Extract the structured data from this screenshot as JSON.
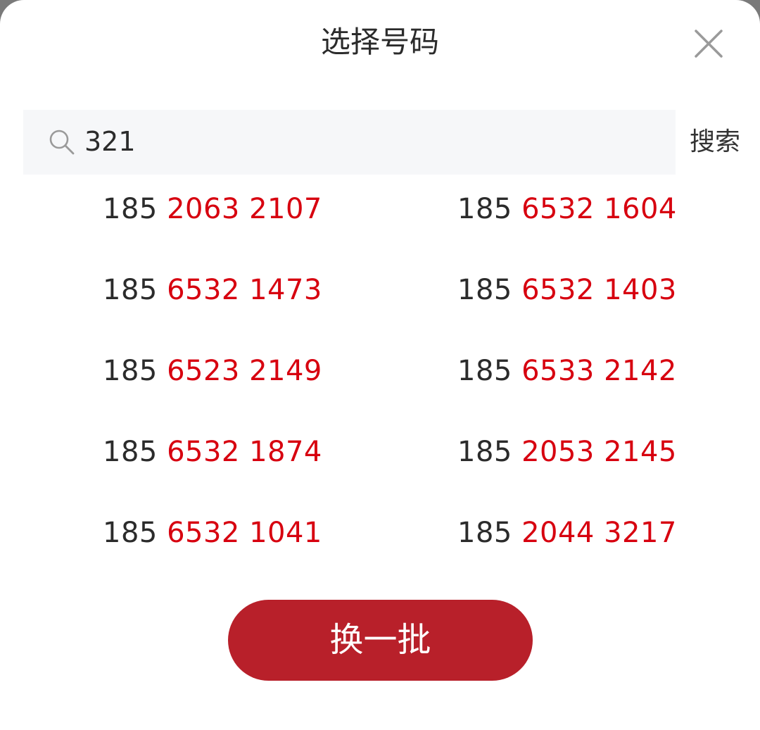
{
  "dialog": {
    "title": "选择号码"
  },
  "search": {
    "value": "321",
    "button_label": "搜索"
  },
  "numbers": [
    {
      "prefix": "185 ",
      "highlight": "2063 2107"
    },
    {
      "prefix": "185 ",
      "highlight": "6532 1604"
    },
    {
      "prefix": "185 ",
      "highlight": "6532 1473"
    },
    {
      "prefix": "185 ",
      "highlight": "6532 1403"
    },
    {
      "prefix": "185 ",
      "highlight": "6523 2149"
    },
    {
      "prefix": "185 ",
      "highlight": "6533 2142"
    },
    {
      "prefix": "185 ",
      "highlight": "6532 1874"
    },
    {
      "prefix": "185 ",
      "highlight": "2053 2145"
    },
    {
      "prefix": "185 ",
      "highlight": "6532 1041"
    },
    {
      "prefix": "185 ",
      "highlight": "2044 3217"
    }
  ],
  "actions": {
    "refresh_label": "换一批"
  },
  "colors": {
    "highlight": "#d7000f",
    "button": "#b8202a"
  },
  "icons": {
    "close": "close-icon",
    "search": "search-icon"
  }
}
